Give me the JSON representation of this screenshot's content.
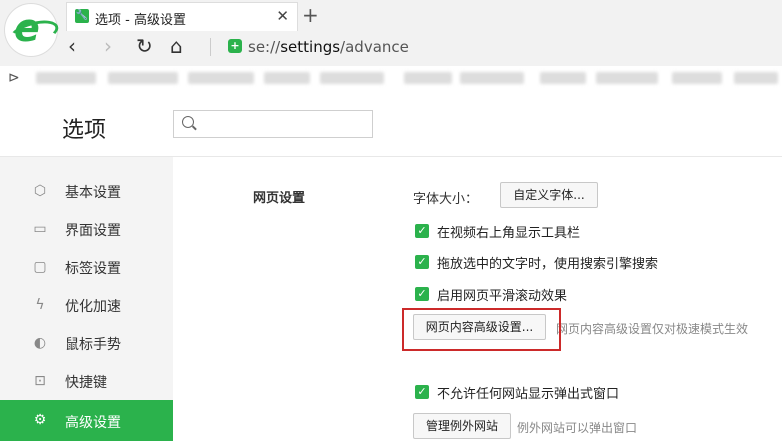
{
  "browser": {
    "tab_title": "选项 - 高级设置",
    "tab_close": "✕",
    "new_tab": "+",
    "url_prefix": "se://",
    "url_host": "settings",
    "url_path": "/advance",
    "nav": {
      "back": "‹",
      "forward": "›",
      "reload": "↻",
      "home": "⌂"
    }
  },
  "page": {
    "title": "选项",
    "search_placeholder": ""
  },
  "sidebar": {
    "items": [
      {
        "label": "基本设置",
        "icon": "⬡",
        "active": false
      },
      {
        "label": "界面设置",
        "icon": "▭",
        "active": false
      },
      {
        "label": "标签设置",
        "icon": "▢",
        "active": false
      },
      {
        "label": "优化加速",
        "icon": "ϟ",
        "active": false
      },
      {
        "label": "鼠标手势",
        "icon": "◐",
        "active": false
      },
      {
        "label": "快捷键",
        "icon": "⊡",
        "active": false
      },
      {
        "label": "高级设置",
        "icon": "⚙",
        "active": true
      }
    ]
  },
  "content": {
    "section_title": "网页设置",
    "font_size_label": "字体大小：",
    "custom_font_button": "自定义字体...",
    "checkboxes": [
      {
        "label": "在视频右上角显示工具栏",
        "checked": true
      },
      {
        "label": "拖放选中的文字时，使用搜索引擎搜索",
        "checked": true
      },
      {
        "label": "启用网页平滑滚动效果",
        "checked": true
      }
    ],
    "advanced_button": "网页内容高级设置...",
    "advanced_note": "网页内容高级设置仅对极速模式生效",
    "popup_checkbox": {
      "label": "不允许任何网站显示弹出式窗口",
      "checked": true
    },
    "manage_button": "管理例外网站",
    "manage_note": "例外网站可以弹出窗口"
  },
  "colors": {
    "accent": "#2bb24c",
    "highlight": "#cc2a2a"
  }
}
